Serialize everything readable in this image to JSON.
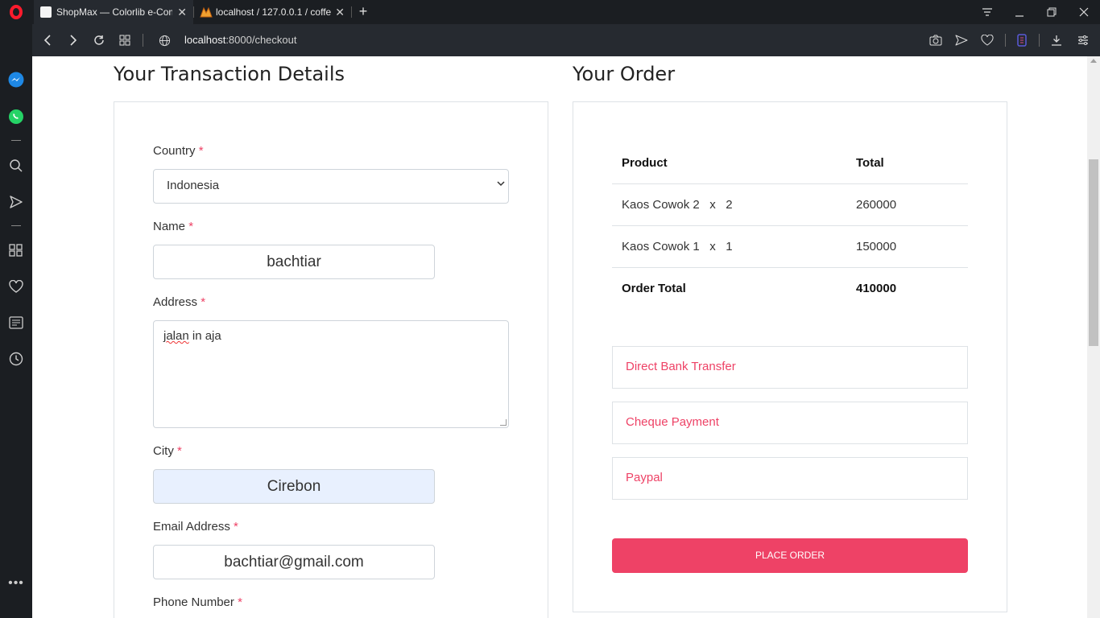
{
  "browser": {
    "tabs": [
      {
        "title": "ShopMax — Colorlib e-Com",
        "active": true
      },
      {
        "title": "localhost / 127.0.0.1 / coffe",
        "active": false
      }
    ],
    "url_host": "localhost",
    "url_rest": ":8000/checkout"
  },
  "transaction": {
    "heading": "Your Transaction Details",
    "country_label": "Country",
    "country_value": "Indonesia",
    "name_label": "Name",
    "name_value": "bachtiar",
    "address_label": "Address",
    "address_word1": "jalan",
    "address_rest": " in aja",
    "city_label": "City",
    "city_value": "Cirebon",
    "email_label": "Email Address",
    "email_value": "bachtiar@gmail.com",
    "phone_label": "Phone Number",
    "required_mark": "*"
  },
  "order": {
    "heading": "Your Order",
    "col_product": "Product",
    "col_total": "Total",
    "items": [
      {
        "product": "Kaos Cowok 2   x   2",
        "total": "260000"
      },
      {
        "product": "Kaos Cowok 1   x   1",
        "total": "150000"
      }
    ],
    "total_label": "Order Total",
    "total_value": "410000",
    "payments": [
      "Direct Bank Transfer",
      "Cheque Payment",
      "Paypal"
    ],
    "place_order": "PLACE ORDER"
  },
  "colors": {
    "accent": "#ee4266",
    "sidebar": "#1b1e22",
    "opera_red": "#ff1b2d"
  }
}
